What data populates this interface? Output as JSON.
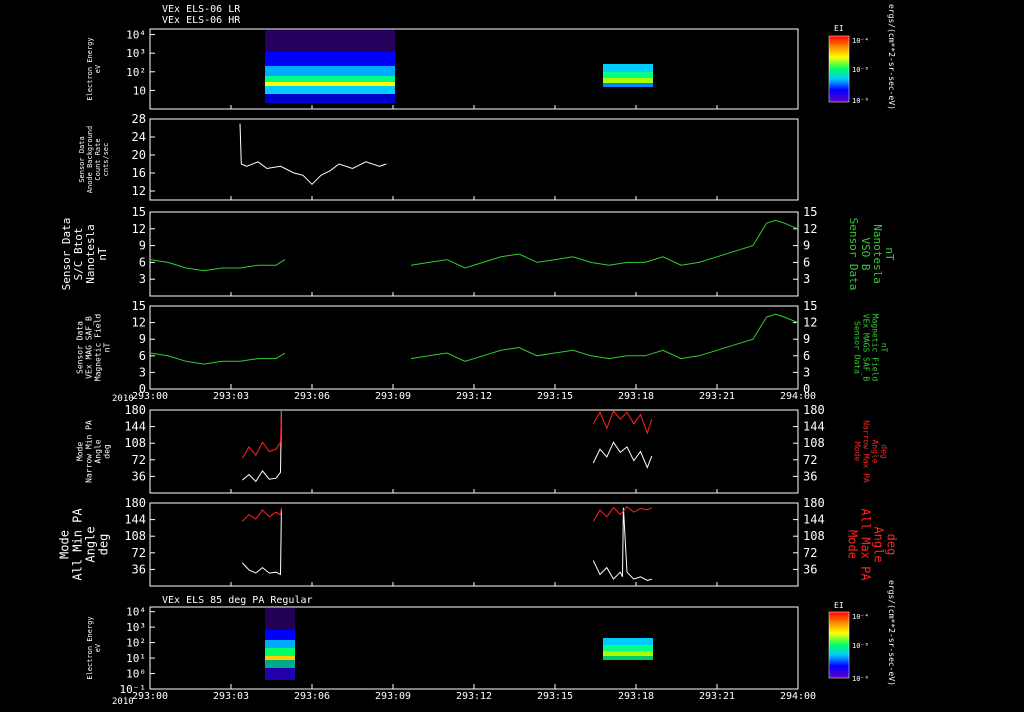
{
  "header": {
    "line1": "VEx ELS-06 LR",
    "line2": "VEx ELS-06 HR",
    "bottom_title": "VEx ELS 85 deg PA Regular"
  },
  "time_axis": {
    "year": "2010",
    "ticks": [
      "293:00",
      "293:03",
      "293:06",
      "293:09",
      "293:12",
      "293:15",
      "293:18",
      "293:21",
      "294:00"
    ],
    "range_minutes": [
      0,
      1440
    ]
  },
  "colorbar": {
    "label": "EI",
    "units": "ergs/(cm**2-sr-sec-eV)",
    "tick_top": "10⁻⁴",
    "tick_mid": "10⁻⁸",
    "tick_bottom": "10⁻⁶"
  },
  "panels": {
    "p1": {
      "left_label": [
        "Electron Energy",
        "eV"
      ]
    },
    "p2": {
      "left_label": [
        "Sensor Data",
        "Anode Background",
        "Count Rate",
        "cnts/sec"
      ]
    },
    "p3": {
      "left_label": [
        "Sensor Data",
        "S/C Btot",
        "Nanotesla",
        "nT"
      ],
      "right_label": [
        "Sensor Data",
        "VSO B",
        "Nanotesla",
        "nT"
      ]
    },
    "p4": {
      "left_label": [
        "Sensor Data",
        "VEx MAG SAF_B",
        "Magnetic Field",
        "nT"
      ],
      "right_label": [
        "Sensor Data",
        "VEx MAGS SAF_B",
        "Magnetic Field",
        "nT"
      ]
    },
    "p5": {
      "left_label": [
        "Mode",
        "Narrow Min PA",
        "Angle",
        "deg"
      ],
      "right_label": [
        "Mode",
        "Narrow Max PA",
        "Angle",
        "deg"
      ]
    },
    "p6": {
      "left_label": [
        "Mode",
        "All Min PA",
        "Angle",
        "deg"
      ],
      "right_label": [
        "Mode",
        "All Max PA",
        "Angle",
        "deg"
      ]
    },
    "p7": {
      "left_label": [
        "Electron Energy",
        "eV"
      ]
    }
  },
  "chart_data": [
    {
      "type": "heatmap",
      "panel": "p1",
      "ylabel": "Electron Energy eV",
      "yscale": "log",
      "ylim": [
        1,
        20000
      ],
      "y_ticks": [
        "10⁴",
        "10³",
        "10²",
        "10"
      ],
      "blocks": [
        {
          "x_start_min": 200,
          "x_end_min": 530,
          "e_low": 3,
          "e_high": 20000
        },
        {
          "x_start_min": 985,
          "x_end_min": 1115,
          "e_low": 8,
          "e_high": 200
        }
      ]
    },
    {
      "type": "line",
      "panel": "p2",
      "ylabel": "Sensor Data Anode Background Count Rate cnts/sec",
      "ylim": [
        10,
        28
      ],
      "y_ticks": [
        12,
        16,
        20,
        24,
        28
      ],
      "series": [
        {
          "color": "#ffffff",
          "x_min": [
            200,
            203,
            215,
            240,
            260,
            290,
            320,
            340,
            360,
            380,
            400,
            420,
            450,
            480,
            510,
            525
          ],
          "y": [
            27,
            18,
            17.5,
            18.5,
            17,
            17.5,
            16,
            15.5,
            13.5,
            15.5,
            16.5,
            18,
            17,
            18.5,
            17.5,
            18
          ]
        }
      ]
    },
    {
      "type": "line",
      "panel": "p3",
      "ylabel": "Sensor Data S/C Btot Nanotesla nT",
      "ylim": [
        0,
        15
      ],
      "y_ticks": [
        3,
        6,
        9,
        12,
        15
      ],
      "series": [
        {
          "color": "#33cc33",
          "x_min": [
            0,
            40,
            80,
            120,
            160,
            200,
            240,
            280,
            300
          ],
          "y": [
            6.5,
            6,
            5,
            4.5,
            5,
            5,
            5.5,
            5.5,
            6.5
          ]
        },
        {
          "color": "#33cc33",
          "x_min": [
            580,
            620,
            660,
            700,
            740,
            780,
            820,
            860,
            900,
            940,
            980,
            1020,
            1060,
            1100,
            1140,
            1180,
            1220,
            1260,
            1300,
            1340,
            1370,
            1390,
            1410,
            1440
          ],
          "y": [
            5.5,
            6,
            6.5,
            5,
            6,
            7,
            7.5,
            6,
            6.5,
            7,
            6,
            5.5,
            6,
            6,
            7,
            5.5,
            6,
            7,
            8,
            9,
            13,
            13.5,
            13,
            12
          ]
        }
      ]
    },
    {
      "type": "line",
      "panel": "p4",
      "ylabel": "Sensor Data VEx MAG SAF_B Magnetic Field nT",
      "ylim": [
        0,
        15
      ],
      "y_ticks": [
        0,
        3,
        6,
        9,
        12,
        15
      ],
      "series": [
        {
          "color": "#33cc33",
          "x_min": [
            0,
            40,
            80,
            120,
            160,
            200,
            240,
            280,
            300
          ],
          "y": [
            6.5,
            6,
            5,
            4.5,
            5,
            5,
            5.5,
            5.5,
            6.5
          ]
        },
        {
          "color": "#33cc33",
          "x_min": [
            580,
            620,
            660,
            700,
            740,
            780,
            820,
            860,
            900,
            940,
            980,
            1020,
            1060,
            1100,
            1140,
            1180,
            1220,
            1260,
            1300,
            1340,
            1370,
            1390,
            1410,
            1440
          ],
          "y": [
            5.5,
            6,
            6.5,
            5,
            6,
            7,
            7.5,
            6,
            6.5,
            7,
            6,
            5.5,
            6,
            6,
            7,
            5.5,
            6,
            7,
            8,
            9,
            13,
            13.5,
            13,
            12
          ]
        }
      ]
    },
    {
      "type": "line",
      "panel": "p5",
      "ylabel": "Mode Narrow Min PA Angle deg",
      "ylim": [
        0,
        180
      ],
      "y_ticks": [
        36,
        72,
        108,
        144,
        180
      ],
      "series": [
        {
          "color": "#ffffff",
          "x_min": [
            205,
            220,
            235,
            250,
            265,
            280,
            290,
            292
          ],
          "y": [
            28,
            40,
            25,
            48,
            30,
            32,
            45,
            180
          ]
        },
        {
          "color": "#ff2222",
          "x_min": [
            205,
            220,
            235,
            250,
            265,
            280,
            290,
            292
          ],
          "y": [
            75,
            100,
            82,
            110,
            90,
            95,
            110,
            180
          ]
        },
        {
          "color": "#ffffff",
          "x_min": [
            985,
            1000,
            1015,
            1030,
            1045,
            1060,
            1075,
            1090,
            1105,
            1115
          ],
          "y": [
            65,
            95,
            78,
            110,
            88,
            100,
            70,
            90,
            55,
            80
          ]
        },
        {
          "color": "#ff2222",
          "x_min": [
            985,
            1000,
            1015,
            1030,
            1045,
            1060,
            1075,
            1090,
            1105,
            1115
          ],
          "y": [
            150,
            175,
            140,
            178,
            160,
            175,
            150,
            170,
            130,
            160
          ]
        }
      ]
    },
    {
      "type": "line",
      "panel": "p6",
      "ylabel": "Mode All Min PA Angle deg",
      "ylim": [
        0,
        180
      ],
      "y_ticks": [
        36,
        72,
        108,
        144,
        180
      ],
      "series": [
        {
          "color": "#ffffff",
          "x_min": [
            205,
            220,
            235,
            250,
            265,
            280,
            290,
            292
          ],
          "y": [
            50,
            35,
            28,
            40,
            28,
            30,
            25,
            165
          ]
        },
        {
          "color": "#ff2222",
          "x_min": [
            205,
            220,
            235,
            250,
            265,
            280,
            290,
            292
          ],
          "y": [
            140,
            155,
            145,
            165,
            150,
            160,
            155,
            170
          ]
        },
        {
          "color": "#ffffff",
          "x_min": [
            985,
            1000,
            1015,
            1030,
            1045,
            1050,
            1052,
            1060,
            1075,
            1090,
            1105,
            1115
          ],
          "y": [
            55,
            25,
            40,
            15,
            30,
            20,
            170,
            30,
            15,
            20,
            12,
            15
          ]
        },
        {
          "color": "#ff2222",
          "x_min": [
            985,
            1000,
            1015,
            1030,
            1045,
            1060,
            1075,
            1090,
            1105,
            1115
          ],
          "y": [
            140,
            165,
            150,
            170,
            155,
            172,
            160,
            168,
            165,
            170
          ]
        }
      ]
    },
    {
      "type": "heatmap",
      "panel": "p7",
      "ylabel": "Electron Energy eV",
      "yscale": "log",
      "ylim": [
        0.1,
        20000
      ],
      "y_ticks": [
        "10⁴",
        "10³",
        "10²",
        "10¹",
        "10⁰",
        "10⁻¹"
      ],
      "blocks": [
        {
          "x_start_min": 200,
          "x_end_min": 305,
          "e_low": 0.3,
          "e_high": 20000
        },
        {
          "x_start_min": 985,
          "x_end_min": 1115,
          "e_low": 3,
          "e_high": 200
        }
      ]
    }
  ]
}
